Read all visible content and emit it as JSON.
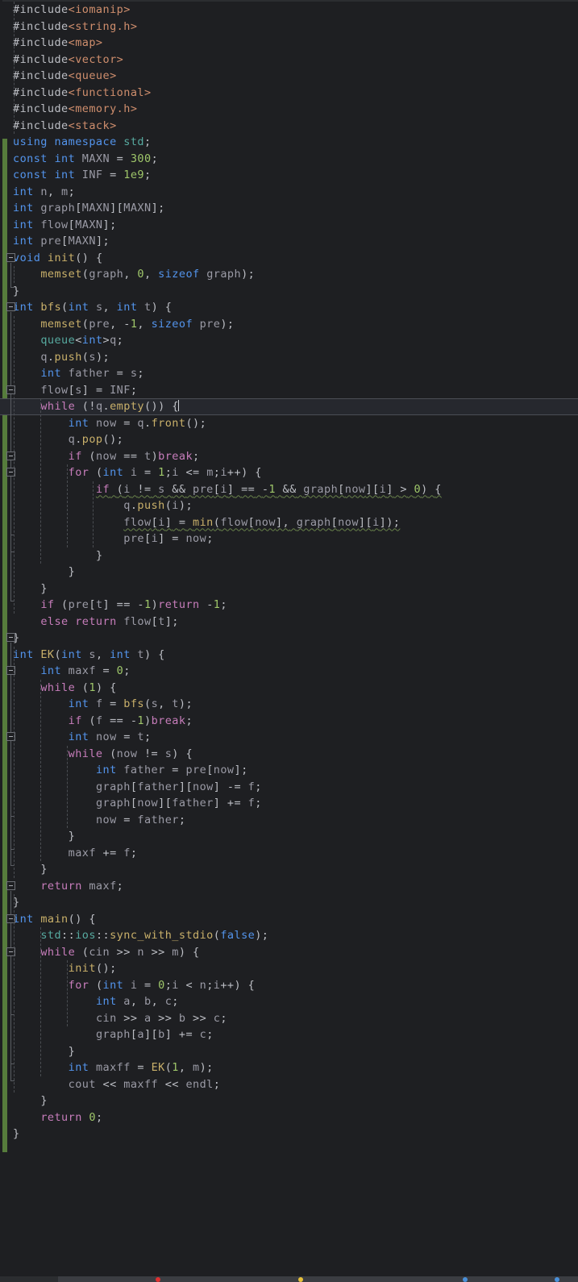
{
  "app": {
    "kind": "code-editor",
    "language": "C++",
    "theme": "dark",
    "colors": {
      "background": "#1e1f22",
      "current_line": "#26282e",
      "change_bar_green": "#567c3c",
      "keyword_blue": "#5394ec",
      "control_magenta": "#c77dbb",
      "type_teal": "#57aaa0",
      "function_yellow": "#c9b06a",
      "number_green": "#9fc76a",
      "preprocessor_orange": "#cf8e6d",
      "default_text": "#bcbec4",
      "warning_squiggle": "#68814a",
      "taskbar": "#3b3d42"
    }
  },
  "editor": {
    "cursor_line_number": 19,
    "cursor_line_text": "    while (!q.empty()) {",
    "lines": [
      "#include<iomanip>",
      "#include<string.h>",
      "#include<map>",
      "#include<vector>",
      "#include<queue>",
      "#include<functional>",
      "#include<memory.h>",
      "#include<stack>",
      "using namespace std;",
      "const int MAXN = 300;",
      "const int INF = 1e9;",
      "int n, m;",
      "int graph[MAXN][MAXN];",
      "int flow[MAXN];",
      "int pre[MAXN];",
      "void init() {",
      "    memset(graph, 0, sizeof graph);",
      "}",
      "int bfs(int s, int t) {",
      "    memset(pre, -1, sizeof pre);",
      "    queue<int>q;",
      "    q.push(s);",
      "    int father = s;",
      "    flow[s] = INF;",
      "    while (!q.empty()) {",
      "        int now = q.front();",
      "        q.pop();",
      "        if (now == t)break;",
      "        for (int i = 1;i <= m;i++) {",
      "            if (i != s && pre[i] == -1 && graph[now][i] > 0) {",
      "                q.push(i);",
      "                flow[i] = min(flow[now], graph[now][i]);",
      "                pre[i] = now;",
      "            }",
      "        }",
      "    }",
      "    if (pre[t] == -1)return -1;",
      "    else return flow[t];",
      "}",
      "int EK(int s, int t) {",
      "    int maxf = 0;",
      "    while (1) {",
      "        int f = bfs(s, t);",
      "        if (f == -1)break;",
      "        int now = t;",
      "        while (now != s) {",
      "            int father = pre[now];",
      "            graph[father][now] -= f;",
      "            graph[now][father] += f;",
      "            now = father;",
      "        }",
      "        maxf += f;",
      "    }",
      "    return maxf;",
      "}",
      "int main() {",
      "    std::ios::sync_with_stdio(false);",
      "    while (cin >> n >> m) {",
      "        init();",
      "        for (int i = 0;i < n;i++) {",
      "            int a, b, c;",
      "            cin >> a >> b >> c;",
      "            graph[a][b] += c;",
      "        }",
      "        int maxff = EK(1, m);",
      "        cout << maxff << endl;",
      "    }",
      "    return 0;",
      "}"
    ],
    "warning_lines": [
      "            if (i != s && pre[i] == -1 && graph[now][i] > 0) {",
      "                flow[i] = min(flow[now], graph[now][i]);"
    ]
  },
  "taskbar": {
    "icons": [
      "record-icon",
      "folder-icon",
      "app-icon-1",
      "app-icon-2"
    ]
  }
}
